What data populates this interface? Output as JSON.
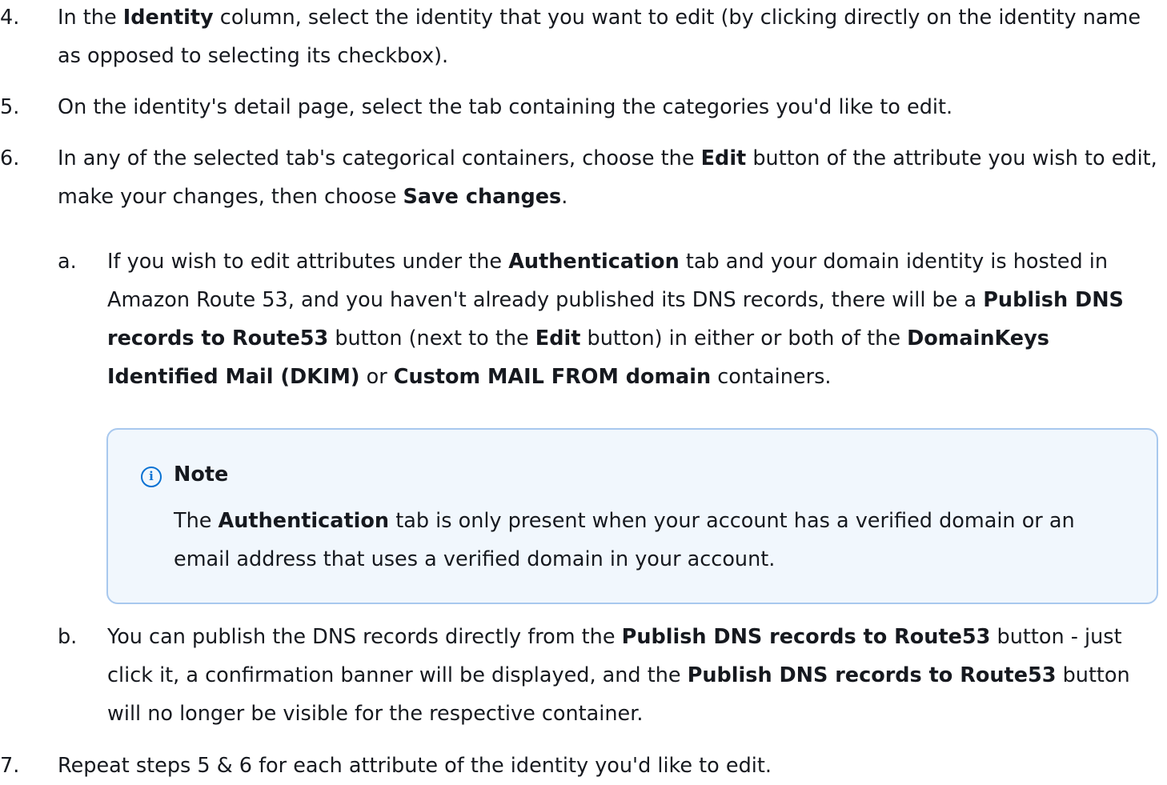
{
  "steps": {
    "s4": {
      "num": "4.",
      "p1": "In the ",
      "b1": "Identity",
      "p2": " column, select the identity that you want to edit (by clicking directly on the identity name as opposed to selecting its checkbox)."
    },
    "s5": {
      "num": "5.",
      "p1": "On the identity's detail page, select the tab containing the categories you'd like to edit."
    },
    "s6": {
      "num": "6.",
      "p1": "In any of the selected tab's categorical containers, choose the ",
      "b1": "Edit",
      "p2": " button of the attribute you wish to edit, make your changes, then choose ",
      "b2": "Save changes",
      "p3": "."
    },
    "s6a": {
      "num": "a.",
      "p1": "If you wish to edit attributes under the ",
      "b1": "Authentication",
      "p2": " tab and your domain identity is hosted in Amazon Route 53, and you haven't already published its DNS records, there will be a ",
      "b2": "Publish DNS records to Route53",
      "p3": " button (next to the ",
      "b3": "Edit",
      "p4": " button) in either or both of the ",
      "b4": "DomainKeys Identified Mail (DKIM)",
      "p5": " or ",
      "b5": "Custom MAIL FROM domain",
      "p6": " containers."
    },
    "note": {
      "icon": "info-icon",
      "title": "Note",
      "p1": "The ",
      "b1": "Authentication",
      "p2": " tab is only present when your account has a verified domain or an email address that uses a verified domain in your account."
    },
    "s6b": {
      "num": "b.",
      "p1": "You can publish the DNS records directly from the ",
      "b1": "Publish DNS records to Route53",
      "p2": " button - just click it, a confirmation banner will be displayed, and the ",
      "b2": "Publish DNS records to Route53",
      "p3": " button will no longer be visible for the respective container."
    },
    "s7": {
      "num": "7.",
      "p1": "Repeat steps 5 & 6 for each attribute of the identity you'd like to edit."
    }
  },
  "colors": {
    "note_border": "#a8c8ee",
    "note_bg": "#f1f7fd",
    "info_icon": "#0972d3",
    "text": "#16191f"
  }
}
